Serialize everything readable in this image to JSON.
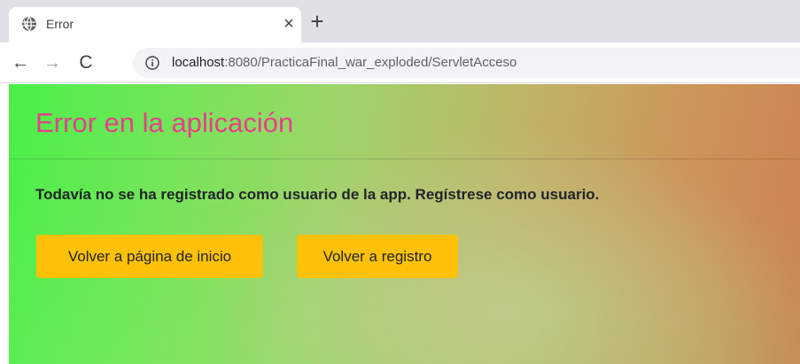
{
  "browser": {
    "tab": {
      "title": "Error",
      "favicon_icon": "globe-icon",
      "close_glyph": "×"
    },
    "new_tab_glyph": "+",
    "nav": {
      "back_glyph": "←",
      "forward_glyph": "→",
      "reload_glyph": "C"
    },
    "address_bar": {
      "site_info_icon": "info-icon",
      "host": "localhost",
      "path": ":8080/PracticaFinal_war_exploded/ServletAcceso"
    }
  },
  "page": {
    "title": "Error en la aplicación",
    "message": "Todavía no se ha registrado como usuario de la app. Regístrese como usuario.",
    "buttons": {
      "home": "Volver a página de inicio",
      "register": "Volver a registro"
    }
  },
  "colors": {
    "title": "#e83e8c",
    "button_warning": "#ffc107",
    "gradient_start": "#49f048",
    "gradient_end": "#cf8052"
  }
}
